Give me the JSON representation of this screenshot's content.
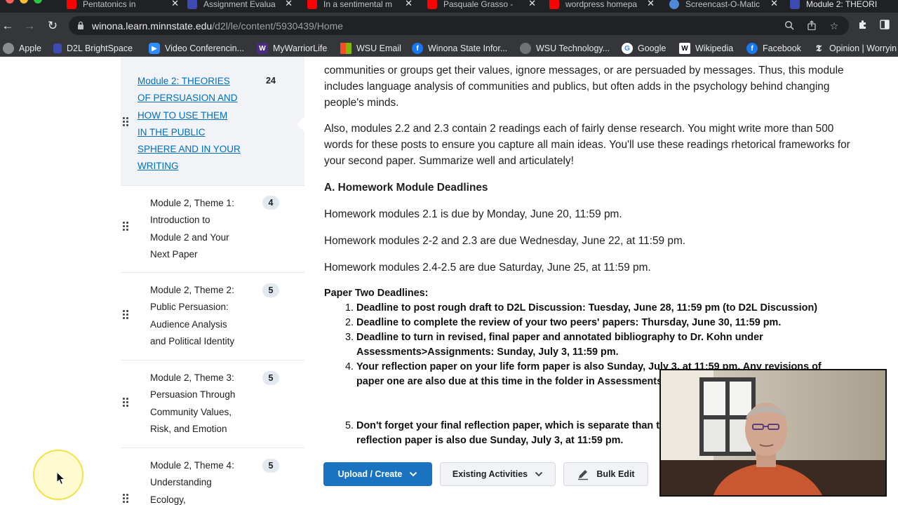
{
  "browser": {
    "tabs": [
      {
        "title": "Pentatonics in",
        "favicon_color": "#ff0000"
      },
      {
        "title": "Assignment Evalua",
        "favicon_color": "#3c4bb0"
      },
      {
        "title": "In a sentimental m",
        "favicon_color": "#ff0000"
      },
      {
        "title": "Pasquale Grasso -",
        "favicon_color": "#ff0000"
      },
      {
        "title": "wordpress homepa",
        "favicon_color": "#ff0000"
      },
      {
        "title": "Screencast-O-Matic",
        "favicon_color": "#4f8ad9"
      },
      {
        "title": "Module 2: THEORI",
        "favicon_color": "#3c4bb0"
      }
    ],
    "url_host": "winona.learn.minnstate.edu",
    "url_path": "/d2l/le/content/5930439/Home",
    "bookmarks": [
      {
        "label": "Apple",
        "icon_color": "#8a8d91"
      },
      {
        "label": "D2L BrightSpace",
        "icon_color": "#3c4bb0"
      },
      {
        "label": "Video Conferencin...",
        "icon_color": "#2d8cff"
      },
      {
        "label": "MyWarriorLife",
        "icon_color": "#4b2a82"
      },
      {
        "label": "WSU Email",
        "icon_color": "#f25022"
      },
      {
        "label": "Winona State Infor...",
        "icon_color": "#1877f2"
      },
      {
        "label": "WSU Technology...",
        "icon_color": "#8a8d91"
      },
      {
        "label": "Google",
        "icon_color": "#ffffff"
      },
      {
        "label": "Wikipedia",
        "icon_color": "#ffffff"
      },
      {
        "label": "Facebook",
        "icon_color": "#1877f2"
      },
      {
        "label": "Opinion | Worryin",
        "icon_color": "#ffffff"
      }
    ]
  },
  "toc": {
    "items": [
      {
        "label_lines": [
          "Module 2: THEORIES",
          "OF PERSUASION AND",
          "HOW TO USE THEM",
          "IN THE PUBLIC",
          "SPHERE AND IN YOUR",
          "WRITING"
        ],
        "count": "24",
        "active": true
      },
      {
        "label_lines": [
          "Module 2, Theme 1:",
          "Introduction to",
          "Module 2 and Your",
          "Next Paper"
        ],
        "count": "4"
      },
      {
        "label_lines": [
          "Module 2, Theme 2:",
          "Public Persuasion:",
          "Audience Analysis",
          "and Political Identity"
        ],
        "count": "5"
      },
      {
        "label_lines": [
          "Module 2, Theme 3:",
          "Persuasion Through",
          "Community Values,",
          "Risk, and Emotion"
        ],
        "count": "5"
      },
      {
        "label_lines": [
          "Module 2, Theme 4:",
          "Understanding",
          "Ecology,"
        ],
        "count": "5"
      }
    ]
  },
  "content": {
    "intro_lines": [
      "communities or groups get their values, ignore messages, or are persuaded by messages. Thus, this module",
      "includes language analysis of communities and publics, but often adds in the psychology behind changing",
      "people's minds."
    ],
    "also_lines": [
      "Also, modules 2.2 and 2.3 contain 2 readings each of fairly dense research. You might write more than 500",
      "words for these posts to ensure you capture all main ideas. You'll use these readings rhetorical frameworks for",
      "your second paper. Summarize well and articulately!"
    ],
    "hw_heading": "A. Homework Module Deadlines",
    "hw_items": [
      "Homework modules 2.1 is due by Monday, June 20, 11:59 pm.",
      "Homework modules 2-2 and 2.3 are due Wednesday, June 22, at 11:59 pm.",
      "Homework modules 2.4-2.5 are due Saturday, June 25, at 11:59 pm."
    ],
    "paper_heading": "Paper Two Deadlines:",
    "paper_items": [
      {
        "num": "1.",
        "lines": [
          "Deadline to post rough draft to D2L Discussion: Tuesday, June 28, 11:59 pm (to D2L Discussion)"
        ]
      },
      {
        "num": "2.",
        "lines": [
          "Deadline to complete the review of your two peers' papers: Thursday, June 30, 11:59 pm."
        ]
      },
      {
        "num": "3.",
        "lines": [
          "Deadline to turn in revised, final paper and annotated bibliography to Dr. Kohn under",
          "Assessments>Assignments: Sunday, July 3, 11:59 pm."
        ]
      },
      {
        "num": "4.",
        "lines": [
          "Your reflection paper on your life form paper is also Sunday, July 3, at 11:59 pm. Any revisions of",
          "paper one are also due at this time in the folder in Assessments>Assignments."
        ]
      },
      {
        "num": "5.",
        "lines": [
          "Don't forget your final reflection paper, which is separate than the above",
          "reflection paper is also due Sunday, July 3, at 11:59 pm."
        ]
      }
    ]
  },
  "actions": {
    "upload": "Upload / Create",
    "existing": "Existing Activities",
    "bulk_edit": "Bulk Edit"
  }
}
